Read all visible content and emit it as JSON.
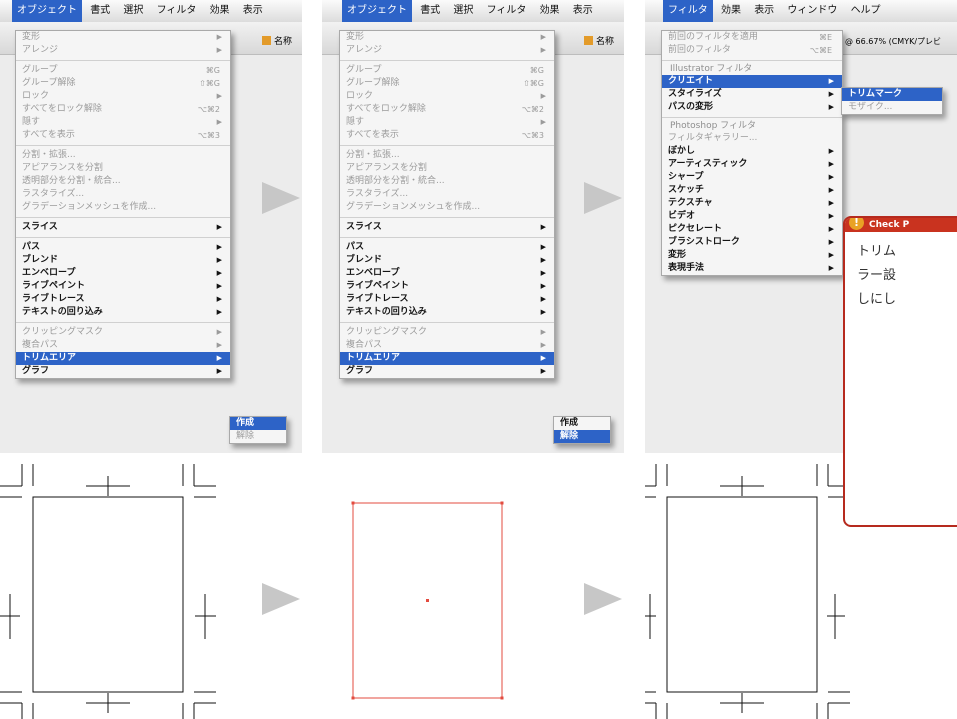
{
  "colors": {
    "menu_highlight": "#2d63c7",
    "trim_area_preview": "#e34b3f",
    "callout_border": "#b62a1e"
  },
  "screen1": {
    "menubar": [
      "オブジェクト",
      "書式",
      "選択",
      "フィルタ",
      "効果",
      "表示"
    ],
    "menu": [
      {
        "label": "変形",
        "arrow": "▶",
        "state": "dis"
      },
      {
        "label": "アレンジ",
        "arrow": "▶",
        "state": "dis"
      },
      {
        "sep": true
      },
      {
        "label": "グループ",
        "shortcut": "⌘G",
        "state": "dis"
      },
      {
        "label": "グループ解除",
        "shortcut": "⇧⌘G",
        "state": "dis"
      },
      {
        "label": "ロック",
        "arrow": "▶",
        "state": "dis"
      },
      {
        "label": "すべてをロック解除",
        "shortcut": "⌥⌘2",
        "state": "dis"
      },
      {
        "label": "隠す",
        "arrow": "▶",
        "state": "dis"
      },
      {
        "label": "すべてを表示",
        "shortcut": "⌥⌘3",
        "state": "dis"
      },
      {
        "sep": true
      },
      {
        "label": "分割・拡張...",
        "state": "dis"
      },
      {
        "label": "アピアランスを分割",
        "state": "dis"
      },
      {
        "label": "透明部分を分割・統合...",
        "state": "dis"
      },
      {
        "label": "ラスタライズ...",
        "state": "dis"
      },
      {
        "label": "グラデーションメッシュを作成...",
        "state": "dis"
      },
      {
        "sep": true
      },
      {
        "label": "スライス",
        "arrow": "▶",
        "state": "en"
      },
      {
        "sep": true
      },
      {
        "label": "パス",
        "arrow": "▶",
        "state": "en"
      },
      {
        "label": "ブレンド",
        "arrow": "▶",
        "state": "en"
      },
      {
        "label": "エンベロープ",
        "arrow": "▶",
        "state": "en"
      },
      {
        "label": "ライブペイント",
        "arrow": "▶",
        "state": "en"
      },
      {
        "label": "ライブトレース",
        "arrow": "▶",
        "state": "en"
      },
      {
        "label": "テキストの回り込み",
        "arrow": "▶",
        "state": "en"
      },
      {
        "sep": true
      },
      {
        "label": "クリッピングマスク",
        "arrow": "▶",
        "state": "dis"
      },
      {
        "label": "複合パス",
        "arrow": "▶",
        "state": "dis"
      },
      {
        "label": "トリムエリア",
        "arrow": "▶",
        "state": "sel"
      },
      {
        "label": "グラフ",
        "arrow": "▶",
        "state": "en"
      }
    ],
    "submenu": [
      {
        "label": "作成",
        "state": "sel"
      },
      {
        "label": "解除",
        "state": "dis"
      }
    ]
  },
  "screen2": {
    "submenu": [
      {
        "label": "作成",
        "state": "en"
      },
      {
        "label": "解除",
        "state": "sel"
      }
    ]
  },
  "screen3": {
    "menubar": [
      "フィルタ",
      "効果",
      "表示",
      "ウィンドウ",
      "ヘルプ"
    ],
    "doc_info": "@ 66.67% (CMYK/プレビ",
    "menu": [
      {
        "label": "前回のフィルタを適用",
        "shortcut": "⌘E",
        "state": "dis"
      },
      {
        "label": "前回のフィルタ",
        "shortcut": "⌥⌘E",
        "state": "dis"
      },
      {
        "sep": true
      },
      {
        "group": "Illustrator フィルタ"
      },
      {
        "label": "クリエイト",
        "arrow": "▶",
        "state": "sel"
      },
      {
        "label": "スタイライズ",
        "arrow": "▶",
        "state": "en"
      },
      {
        "label": "パスの変形",
        "arrow": "▶",
        "state": "en"
      },
      {
        "sep": true
      },
      {
        "group": "Photoshop フィルタ"
      },
      {
        "label": "フィルタギャラリー...",
        "state": "dis"
      },
      {
        "label": "ぼかし",
        "arrow": "▶",
        "state": "en"
      },
      {
        "label": "アーティスティック",
        "arrow": "▶",
        "state": "en"
      },
      {
        "label": "シャープ",
        "arrow": "▶",
        "state": "en"
      },
      {
        "label": "スケッチ",
        "arrow": "▶",
        "state": "en"
      },
      {
        "label": "テクスチャ",
        "arrow": "▶",
        "state": "en"
      },
      {
        "label": "ビデオ",
        "arrow": "▶",
        "state": "en"
      },
      {
        "label": "ピクセレート",
        "arrow": "▶",
        "state": "en"
      },
      {
        "label": "ブラシストローク",
        "arrow": "▶",
        "state": "en"
      },
      {
        "label": "変形",
        "arrow": "▶",
        "state": "en"
      },
      {
        "label": "表現手法",
        "arrow": "▶",
        "state": "en"
      }
    ],
    "submenu": [
      {
        "label": "トリムマーク",
        "state": "sel"
      },
      {
        "label": "モザイク...",
        "state": "dis"
      }
    ]
  },
  "toolbar_label": "名称",
  "check_point": {
    "header": "Check P",
    "icon": "exclamation-icon",
    "lines": [
      "トリム",
      "ラー設",
      "しにし"
    ]
  }
}
